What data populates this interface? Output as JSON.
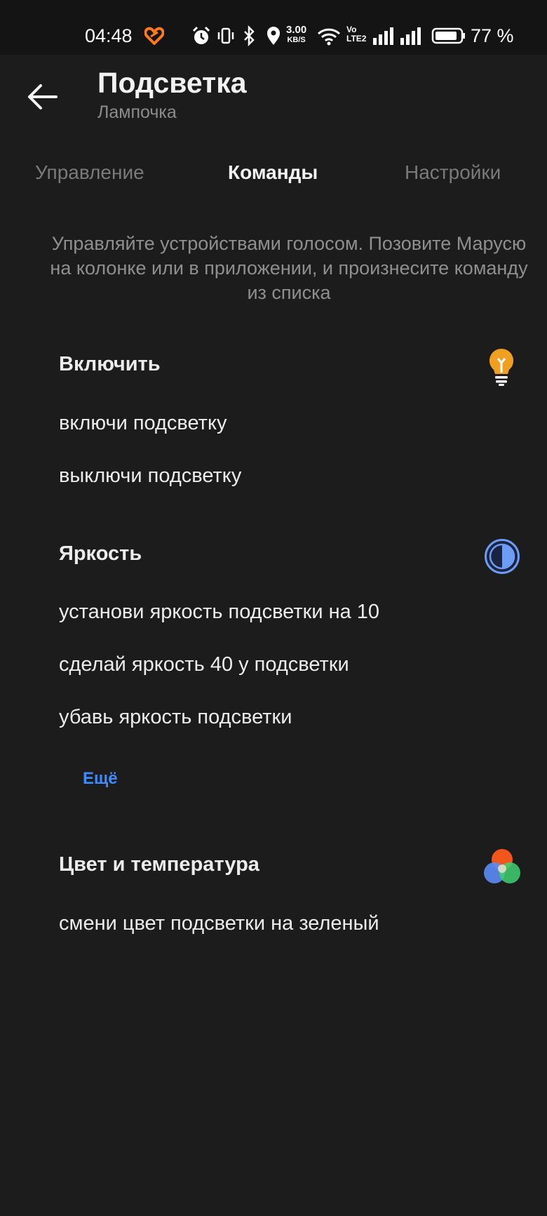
{
  "status_bar": {
    "time": "04:48",
    "speed_value": "3.00",
    "speed_unit": "KB/S",
    "volte_top": "Vo",
    "volte_bottom": "LTE2",
    "battery": "77 %",
    "icons": [
      "heart-icon",
      "alarm-icon",
      "vibrate-icon",
      "bluetooth-icon",
      "location-icon",
      "wifi-icon",
      "signal-icon",
      "battery-icon"
    ]
  },
  "header": {
    "title": "Подсветка",
    "subtitle": "Лампочка"
  },
  "tabs": [
    {
      "label": "Управление",
      "active": false
    },
    {
      "label": "Команды",
      "active": true
    },
    {
      "label": "Настройки",
      "active": false
    }
  ],
  "intro_lines": [
    "Управляйте устройствами голосом. Позовите Марусю",
    "на колонке или в приложении, и произнесите команду",
    "из списка"
  ],
  "sections": [
    {
      "title": "Включить",
      "icon": "lightbulb-icon",
      "commands": [
        "включи подсветку",
        "выключи подсветку"
      ]
    },
    {
      "title": "Яркость",
      "icon": "brightness-icon",
      "commands": [
        "установи яркость подсветки на 10",
        "сделай яркость 40 у подсветки",
        "убавь яркость подсветки"
      ],
      "more_label": "Ещё"
    },
    {
      "title": "Цвет и температура",
      "icon": "color-circles-icon",
      "commands": [
        "смени цвет подсветки на зеленый"
      ]
    }
  ],
  "colors": {
    "background": "#1c1c1c",
    "accent": "#3b8cff",
    "bulb": "#f0a020",
    "heart": "#ff7a1a"
  }
}
